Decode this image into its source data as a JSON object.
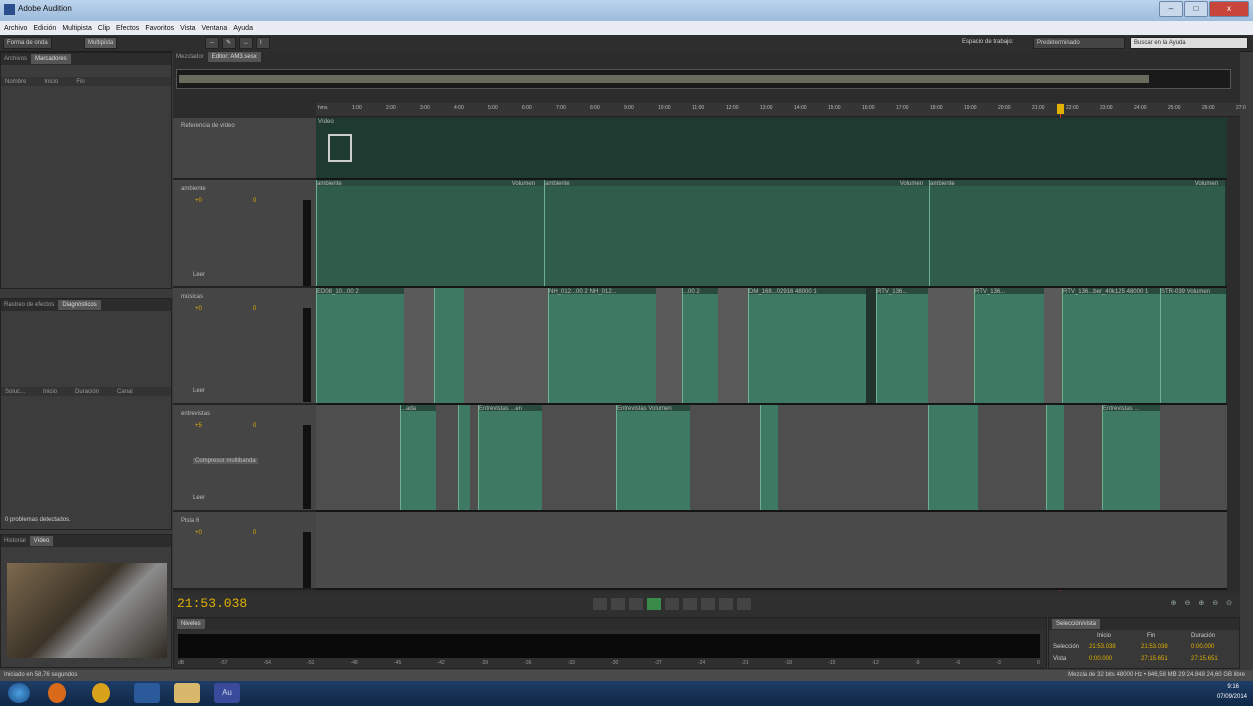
{
  "window": {
    "title": "Adobe Audition",
    "min": "–",
    "max": "□",
    "close": "x"
  },
  "menu": [
    "Archivo",
    "Edición",
    "Multipista",
    "Clip",
    "Efectos",
    "Favoritos",
    "Vista",
    "Ventana",
    "Ayuda"
  ],
  "toolbar": {
    "waveform": "Forma de onda",
    "multitrack": "Multipista",
    "workspace_label": "Espacio de trabajo:",
    "workspace_value": "Predeterminado",
    "search": "Buscar en la Ayuda"
  },
  "left_top": {
    "tabs": [
      "Archivos",
      "Marcadores"
    ],
    "col_name": "Nombre",
    "col_start": "Inicio",
    "col_end": "Fin"
  },
  "left_mid": {
    "tabs": [
      "Rastreo de efectos",
      "Diagnósticos"
    ],
    "col1": "Soluc...",
    "col2": "Inicio",
    "col3": "Duración",
    "col4": "Canal",
    "status": "0 problemas detectados."
  },
  "left_bottom": {
    "tabs": [
      "Historial",
      "Vídeo"
    ]
  },
  "editor": {
    "tab_mixer": "Mezclador",
    "tab_editor": "Editor: AM3.sesx"
  },
  "ruler": [
    "hms",
    "1:00",
    "2:00",
    "3:00",
    "4:00",
    "5:00",
    "6:00",
    "7:00",
    "8:00",
    "9:00",
    "10:00",
    "11:00",
    "12:00",
    "13:00",
    "14:00",
    "15:00",
    "16:00",
    "17:00",
    "18:00",
    "19:00",
    "20:00",
    "21:00",
    "22:00",
    "23:00",
    "24:00",
    "25:00",
    "26:00",
    "27:0"
  ],
  "video_track": {
    "name": "Referencia de vídeo",
    "clip": "Vídeo"
  },
  "tracks": [
    {
      "name": "ambiente",
      "vol": "+0",
      "pan": "0",
      "fx": "Leer",
      "clip_labels": [
        "ambiente",
        "Volumen",
        "ambiente",
        "Volumen",
        "ambiente",
        "Volumen"
      ]
    },
    {
      "name": "músicas",
      "vol": "+0",
      "pan": "0",
      "fx": "Leer",
      "clip_labels": [
        "ED08_10...00 2",
        "NH_012...00 2",
        "NH_012...",
        "...00 2",
        "DM_168...02916 48000 1",
        "RTV_136...",
        "RTV_136...",
        "RTV_136...ber_40k125 48000 1",
        "STR-039 Volumen"
      ]
    },
    {
      "name": "entrevistas",
      "vol": "+5",
      "pan": "0",
      "fx": "Leer",
      "insert": "Compresor multibanda",
      "clip_labels": [
        "...ada",
        "Entrevistas ...en",
        "Entrevistas Volumen",
        "Entrevistas ..."
      ]
    },
    {
      "name": "Pista 6",
      "vol": "+0",
      "pan": "0",
      "fx": ""
    }
  ],
  "time": "21:53.038",
  "levels": {
    "title": "Niveles",
    "scale": [
      "dB",
      "-57",
      "-54",
      "-51",
      "-48",
      "-45",
      "-42",
      "-39",
      "-36",
      "-33",
      "-30",
      "-27",
      "-24",
      "-21",
      "-18",
      "-15",
      "-12",
      "-9",
      "-6",
      "-3",
      "0"
    ]
  },
  "selection": {
    "title": "Selección/vista",
    "hdr_start": "Inicio",
    "hdr_end": "Fin",
    "hdr_dur": "Duración",
    "row1": "Selección",
    "row2": "Vista",
    "sel_start": "21:53.038",
    "sel_end": "21:53.038",
    "sel_dur": "0:00.000",
    "view_start": "0:00.000",
    "view_end": "27:15.651",
    "view_dur": "27:15.651"
  },
  "status": {
    "left": "Iniciado en 58,76 segundos",
    "right": "Mezcla de 32 bits 48000 Hz • 846,58 MB  29:24.848  24,60 GB libre"
  },
  "clock": {
    "time": "9:16",
    "date": "07/09/2014"
  }
}
